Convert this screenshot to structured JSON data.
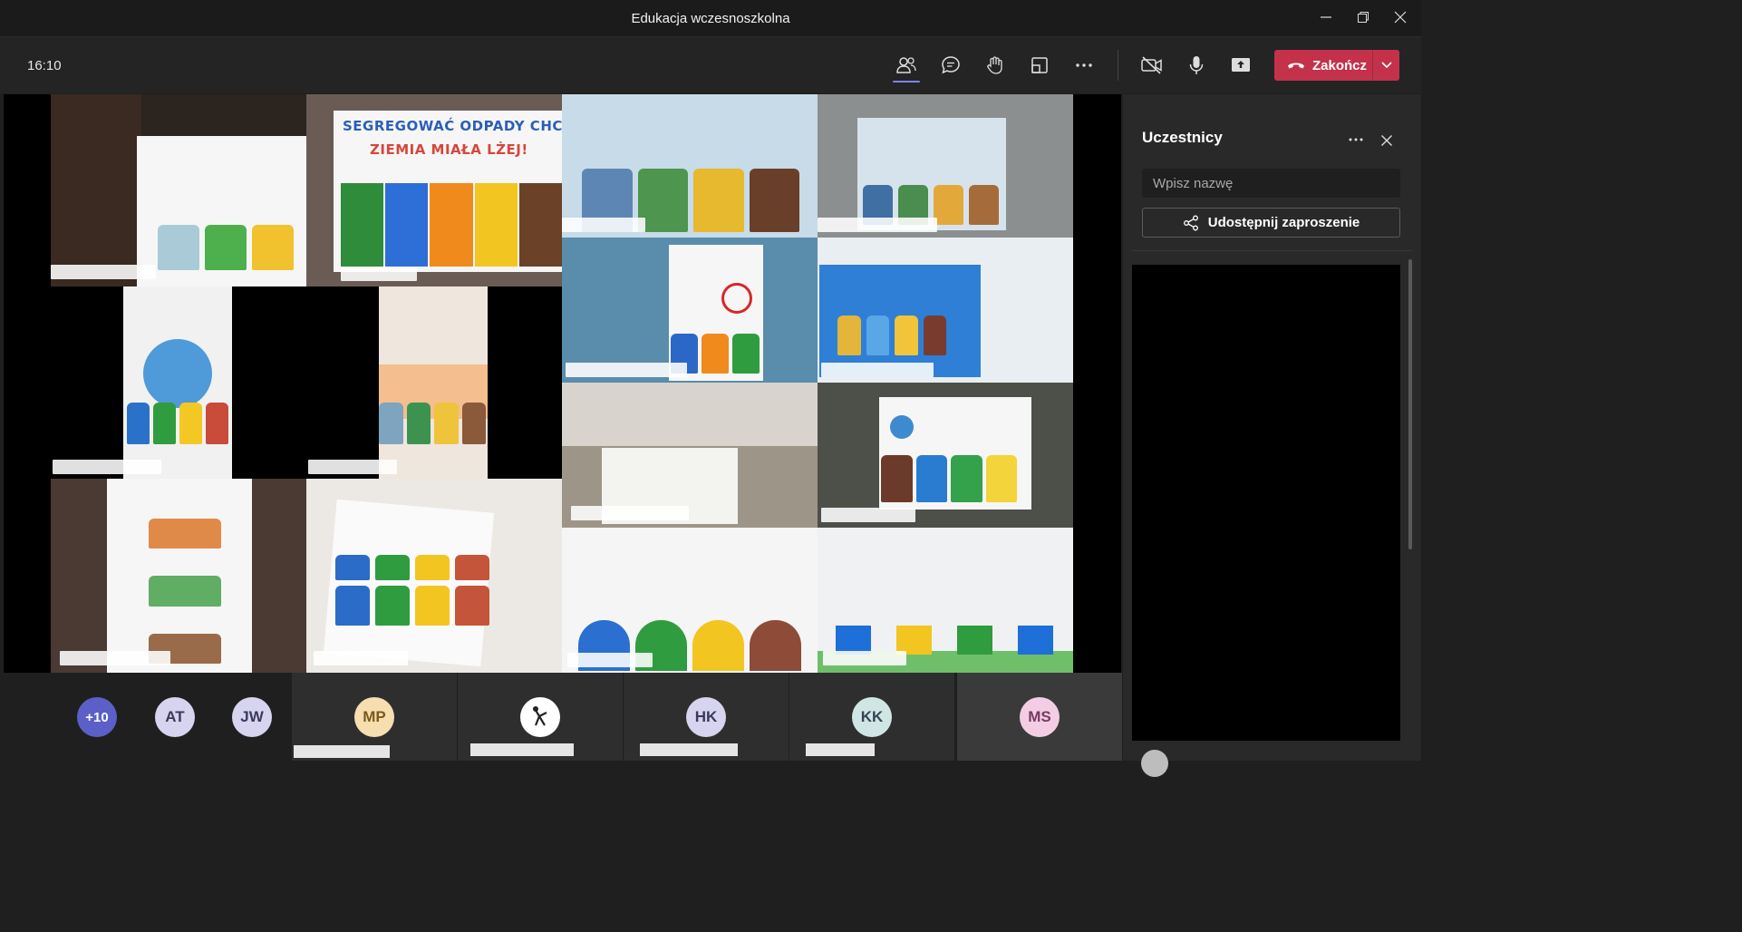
{
  "window": {
    "title": "Edukacja wczesnoszkolna"
  },
  "toolbar": {
    "time": "16:10",
    "end_call_label": "Zakończ",
    "buttons": [
      "participants-icon",
      "chat-icon",
      "raise-hand-icon",
      "rooms-icon",
      "more-icon",
      "camera-off-icon",
      "mic-icon",
      "share-screen-icon"
    ]
  },
  "video_grid": {
    "poster_title_line1": "SEGREGOWAĆ ODPADY CHCĘ, BĘDZIE",
    "poster_title_line2": "ZIEMIA MIAŁA LŻEJ!"
  },
  "participants_panel": {
    "title": "Uczestnicy",
    "search_placeholder": "Wpisz nazwę",
    "invite_label": "Udostępnij zaproszenie"
  },
  "strip": {
    "overflow": "+10",
    "avatars": [
      {
        "initials": "AT",
        "color": "#d6d4ef"
      },
      {
        "initials": "JW",
        "color": "#d6d4ef"
      }
    ],
    "tiles": [
      {
        "initials": "MP",
        "color": "#f7deb0"
      },
      {
        "initials": "",
        "color": "#ffffff"
      },
      {
        "initials": "HK",
        "color": "#d6d4ef"
      },
      {
        "initials": "KK",
        "color": "#cfe6e4"
      },
      {
        "initials": "MS",
        "color": "#f3cde4"
      }
    ]
  },
  "colors": {
    "accent": "#7f85f5",
    "end_call": "#c4314b",
    "panel_bg": "#292929"
  }
}
